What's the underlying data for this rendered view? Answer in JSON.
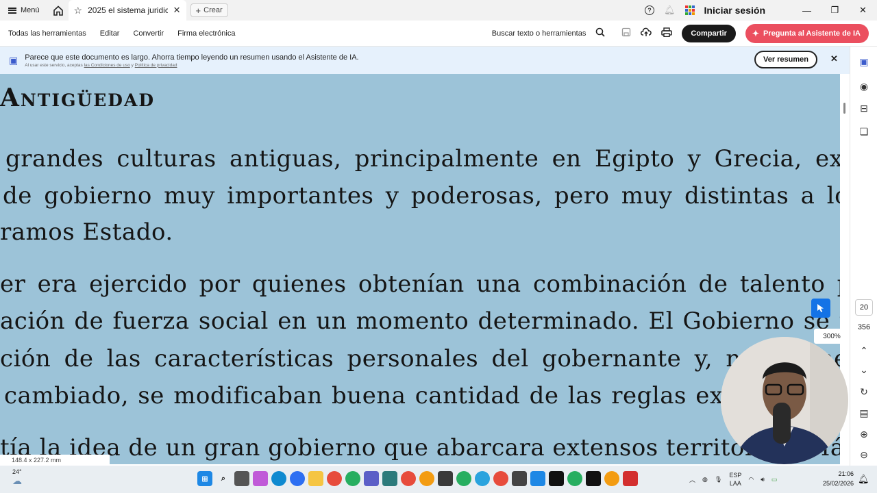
{
  "tabbar": {
    "menu_label": "Menú",
    "tab_title": "2025 el sistema juridic...",
    "create_label": "Crear",
    "signin_label": "Iniciar sesión"
  },
  "toolbar": {
    "items": [
      "Todas las herramientas",
      "Editar",
      "Convertir",
      "Firma electrónica"
    ],
    "search_label": "Buscar texto o herramientas",
    "share_label": "Compartir",
    "ai_label": "Pregunta al Asistente de IA",
    "ai_color": "#eb4f5f"
  },
  "banner": {
    "message": "Parece que este documento es largo. Ahorra tiempo leyendo un resumen usando el Asistente de IA.",
    "sub_prefix": "Al usar este servicio, aceptas",
    "terms_link": "las Condiciones de uso",
    "and": "y",
    "privacy_link": "Política de privacidad",
    "summary_button": "Ver resumen"
  },
  "document": {
    "heading": "Antigüedad",
    "lines": [
      "grandes culturas antiguas, principalmente en Egipto y Grecia, existieron",
      "de gobierno muy importantes y poderosas, pero muy distintas a lo que ho",
      "ramos Estado.",
      "er era ejercido por quienes obtenían una combinación de talento personal",
      "ación de fuerza social en un momento determinado. El Gobierno se mode",
      "ción de las características personales del gobernante y, normalmen",
      "cambiado, se modificaban buena cantidad de las reglas existentes",
      "tía la idea de un gran gobierno que abarcara extensos territorios. Más"
    ],
    "background": "#9cc3d8"
  },
  "rightbar": {
    "current_page": "20",
    "total_pages": "356",
    "zoom": "300%"
  },
  "statusbar": {
    "page_size": "148.4 x 227.2 mm"
  },
  "taskbar": {
    "temperature": "24°",
    "lang_top": "ESP",
    "lang_bottom": "LAA",
    "time": "21:06",
    "date": "25/02/2026"
  }
}
